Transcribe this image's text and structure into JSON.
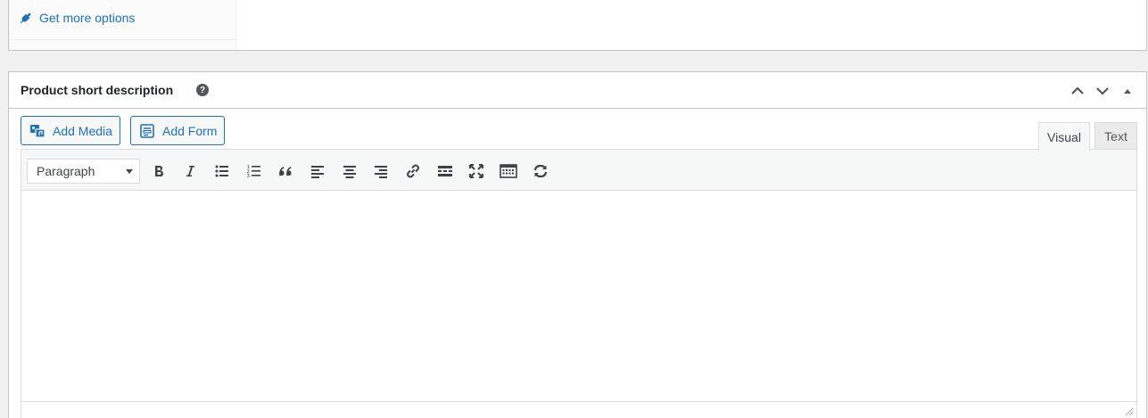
{
  "product_data": {
    "more_options_label": "Get more options",
    "more_options_icon": "plugins-icon"
  },
  "short_description": {
    "title": "Product short description",
    "help_icon": "?",
    "actions": [
      "move-up-icon",
      "move-down-icon",
      "toggle-panel-icon"
    ]
  },
  "media_buttons": {
    "add_media": "Add Media",
    "add_form": "Add Form"
  },
  "editor_tabs": {
    "visual": "Visual",
    "text": "Text",
    "active": "visual"
  },
  "toolbar": {
    "format_value": "Paragraph",
    "buttons": [
      "bold",
      "italic",
      "bulleted-list",
      "numbered-list",
      "blockquote",
      "align-left",
      "align-center",
      "align-right",
      "insert-link",
      "read-more",
      "fullscreen",
      "toolbar-toggle",
      "refresh"
    ]
  },
  "colors": {
    "link": "#2271b1",
    "border": "#c3c4c7",
    "toolbar_bg": "#f6f7f7",
    "page_bg": "#f0f0f1"
  }
}
